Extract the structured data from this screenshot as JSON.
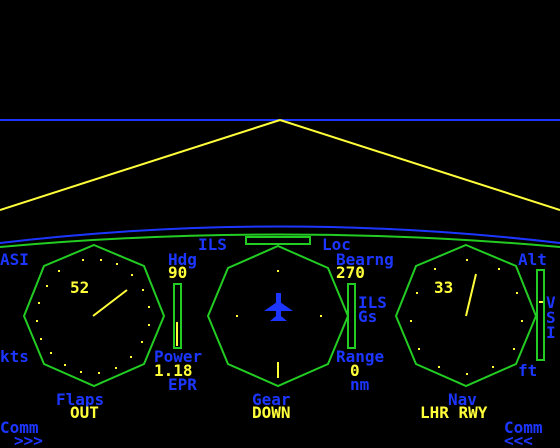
{
  "colors": {
    "blue": "#1c36ff",
    "yellow": "#ffff3a",
    "green": "#22cc22",
    "background": "#000000"
  },
  "labels": {
    "ils": "ILS",
    "loc": "Loc",
    "asi": "ASI",
    "alt": "Alt",
    "hdg": "Hdg",
    "bearing": "Bearng",
    "kts": "kts",
    "ils_gs": "ILS",
    "gs": "Gs",
    "vsi": [
      "V",
      "S",
      "I"
    ],
    "power": "Power",
    "epr": "EPR",
    "range": "Range",
    "nm": "nm",
    "ft": "ft",
    "flaps": "Flaps",
    "gear": "Gear",
    "nav": "Nav",
    "comm_left": "Comm",
    "comm_right": "Comm"
  },
  "values": {
    "asi": "52",
    "heading": "90",
    "bearing": "270",
    "altitude": "33",
    "power": "1.18",
    "range": "0",
    "flaps": "OUT",
    "gear": "DOWN",
    "nav": "LHR RWY",
    "comm_left_arrows": ">>>",
    "comm_right_arrows": "<<<"
  },
  "icons": {
    "attitude": "aircraft-icon"
  }
}
